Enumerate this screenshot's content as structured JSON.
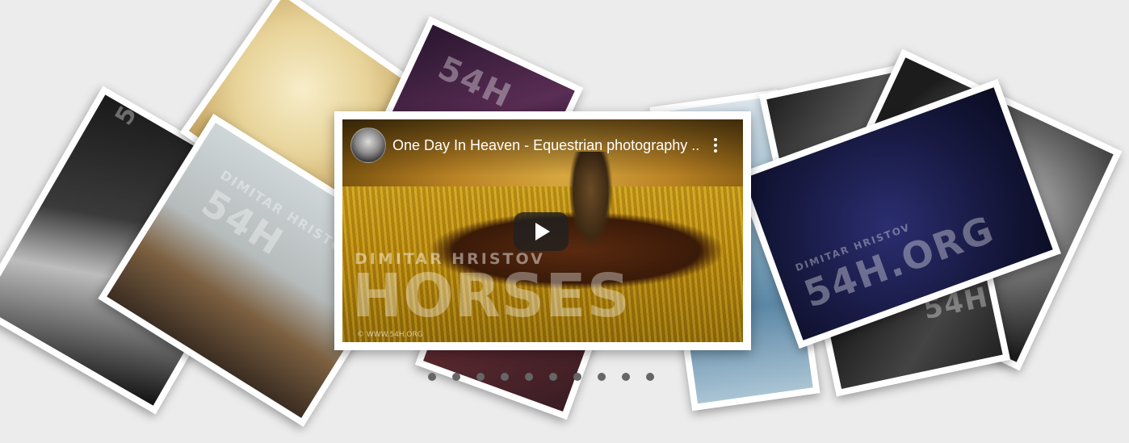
{
  "video": {
    "title": "One Day In Heaven - Equestrian photography ...",
    "watermark_name": "DIMITAR HRISTOV",
    "watermark_big": "HORSES",
    "watermark_url": "© WWW.54H.ORG"
  },
  "watermarks": {
    "brand": "54H.ORG",
    "name": "DIMITAR HRISTOV",
    "brand_short": "54H"
  },
  "pagination": {
    "count": 10,
    "active_index": 0
  },
  "icons": {
    "play": "play-icon",
    "more": "more-vert-icon",
    "avatar": "channel-avatar"
  },
  "colors": {
    "background": "#ececec",
    "dot": "#666666",
    "frame": "#ffffff"
  }
}
